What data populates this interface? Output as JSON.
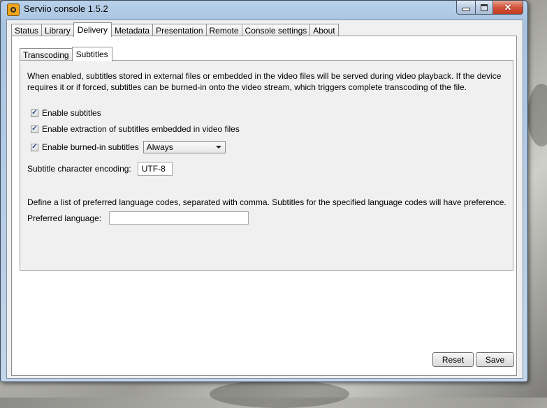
{
  "window": {
    "title": "Serviio console 1.5.2",
    "close_glyph": "✕"
  },
  "main_tabs": [
    {
      "label": "Status"
    },
    {
      "label": "Library"
    },
    {
      "label": "Delivery"
    },
    {
      "label": "Metadata"
    },
    {
      "label": "Presentation"
    },
    {
      "label": "Remote"
    },
    {
      "label": "Console settings"
    },
    {
      "label": "About"
    }
  ],
  "active_main_tab": "Delivery",
  "sub_tabs": [
    {
      "label": "Transcoding"
    },
    {
      "label": "Subtitles"
    }
  ],
  "active_sub_tab": "Subtitles",
  "subtitles": {
    "description": "When enabled, subtitles stored in external files or embedded in the video files will be served during video playback. If the device requires it or if forced, subtitles can be burned-in onto the video stream, which triggers complete transcoding of the file.",
    "enable_subtitles": {
      "label": "Enable subtitles",
      "checked": true
    },
    "enable_extraction": {
      "label": "Enable extraction of subtitles embedded in video files",
      "checked": true
    },
    "enable_burned_in": {
      "label": "Enable burned-in subtitles",
      "checked": true,
      "selected": "Always"
    },
    "encoding": {
      "label": "Subtitle character encoding:",
      "value": "UTF-8"
    },
    "language_hint": "Define a list of preferred language codes, separated with comma. Subtitles for the specified language codes will have preference.",
    "preferred_language": {
      "label": "Preferred language:",
      "value": ""
    }
  },
  "buttons": {
    "reset": "Reset",
    "save": "Save"
  },
  "check_glyph": "✓"
}
